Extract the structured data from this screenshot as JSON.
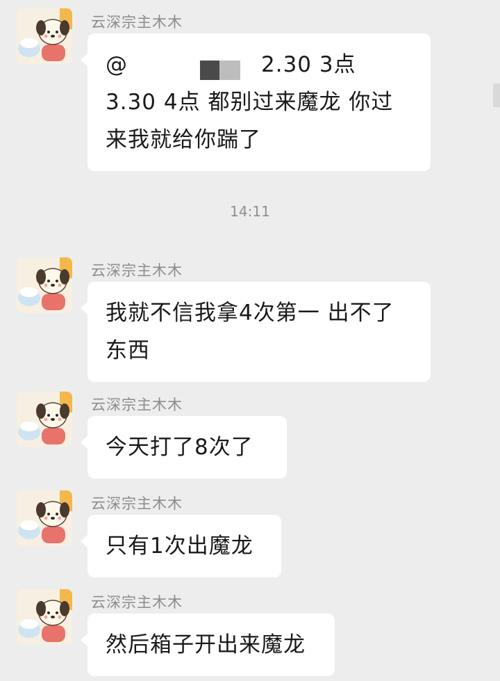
{
  "timestamp": "14:11",
  "sender_name": "云深宗主木木",
  "messages": [
    {
      "text_pre": "@",
      "text": "2.30 3点 3.30 4点 都别过来魔龙 你过来我就给你踹了"
    },
    {
      "text": "我就不信我拿4次第一 出不了东西"
    },
    {
      "text": "今天打了8次了"
    },
    {
      "text": "只有1次出魔龙"
    },
    {
      "text": "然后箱子开出来魔龙"
    }
  ],
  "colors": {
    "background": "#ededed",
    "bubble": "#ffffff",
    "sender_text": "#8c8c8c",
    "message_text": "#1a1a1a"
  }
}
